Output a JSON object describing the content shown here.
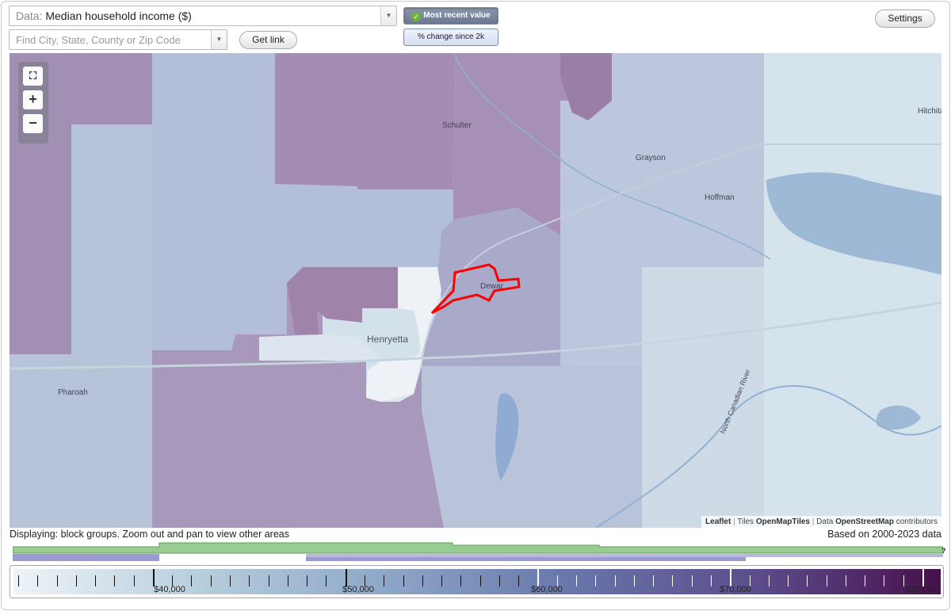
{
  "data_selector": {
    "prefix": "Data:",
    "value": "Median household income ($)"
  },
  "search": {
    "placeholder": "Find City, State, County or Zip Code"
  },
  "buttons": {
    "get_link": "Get link",
    "settings": "Settings",
    "most_recent": "Most recent value",
    "percent_change": "% change since 2k"
  },
  "map": {
    "places": [
      "Schulter",
      "Grayson",
      "Hoffman",
      "Hitchita",
      "Dewar",
      "Henryetta",
      "Pharoah",
      "North Canadian River"
    ],
    "zoom_in": "+",
    "zoom_out": "−",
    "attribution": {
      "leaflet": "Leaflet",
      "tiles_prefix": "Tiles",
      "tiles": "OpenMapTiles",
      "data_prefix": "Data",
      "data": "OpenStreetMap",
      "data_suffix": "contributors"
    },
    "highlight_color": "#ff0000"
  },
  "status": {
    "displaying": "Displaying: block groups. Zoom out and pan to view other areas",
    "based_on": "Based on 2000-2023 data",
    "help": "?"
  },
  "legend": {
    "labels": [
      "$40,000",
      "$50,000",
      "$60,000",
      "$70,000",
      "$80,000"
    ],
    "min_value": 30000,
    "max_value": 80000,
    "label_values": [
      40000,
      50000,
      60000,
      70000,
      80000
    ],
    "colors": [
      "#eef4f8",
      "#b7cedd",
      "#8ea7c7",
      "#6876aa",
      "#5c4d8d",
      "#47104b"
    ]
  }
}
